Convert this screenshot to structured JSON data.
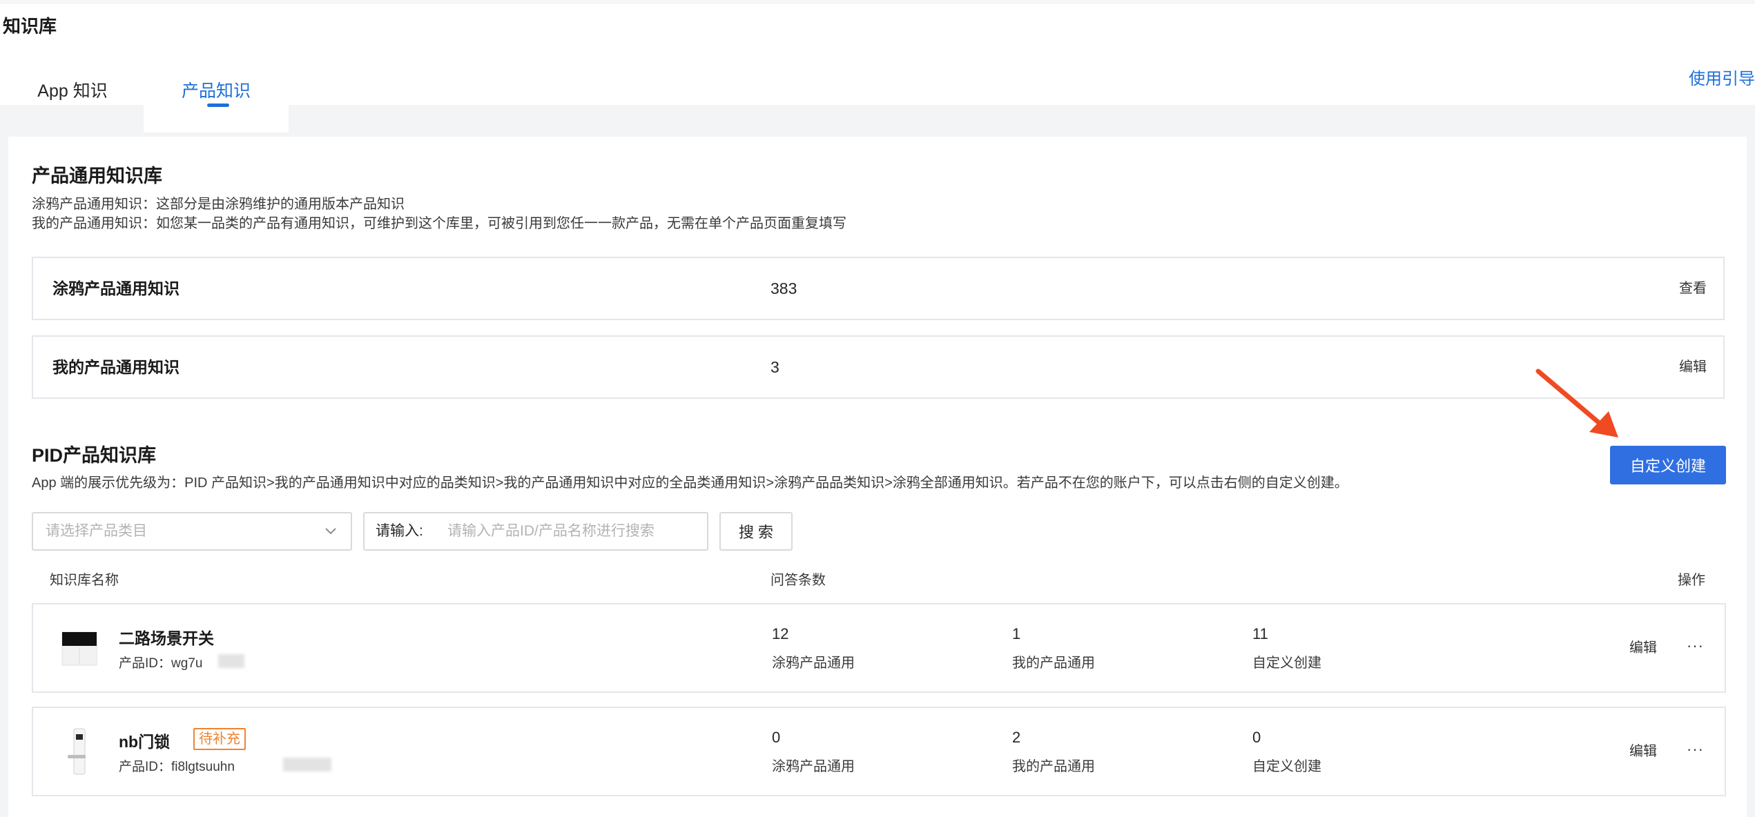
{
  "page": {
    "title": "知识库",
    "guide_link": "使用引导"
  },
  "tabs": [
    {
      "label": "App 知识",
      "active": false
    },
    {
      "label": "产品知识",
      "active": true
    }
  ],
  "general_kb": {
    "title": "产品通用知识库",
    "desc_line1": "涂鸦产品通用知识：这部分是由涂鸦维护的通用版本产品知识",
    "desc_line2": "我的产品通用知识：如您某一品类的产品有通用知识，可维护到这个库里，可被引用到您任一一款产品，无需在单个产品页面重复填写",
    "rows": [
      {
        "name": "涂鸦产品通用知识",
        "count": "383",
        "action": "查看"
      },
      {
        "name": "我的产品通用知识",
        "count": "3",
        "action": "编辑"
      }
    ]
  },
  "pid_kb": {
    "title": "PID产品知识库",
    "desc": "App 端的展示优先级为：PID 产品知识>我的产品通用知识中对应的品类知识>我的产品通用知识中对应的全品类通用知识>涂鸦产品品类知识>涂鸦全部通用知识。若产品不在您的账户下，可以点击右侧的自定义创建。",
    "create_button": "自定义创建",
    "filter": {
      "category_placeholder": "请选择产品类目",
      "input_label": "请输入:",
      "input_placeholder": "请输入产品ID/产品名称进行搜索",
      "search_button": "搜 索"
    },
    "table_headers": {
      "name": "知识库名称",
      "qa_count": "问答条数",
      "ops": "操作"
    },
    "products": [
      {
        "name": "二路场景开关",
        "badge": "",
        "id_text": "产品ID：wg7u",
        "stats": [
          {
            "value": "12",
            "label": "涂鸦产品通用"
          },
          {
            "value": "1",
            "label": "我的产品通用"
          },
          {
            "value": "11",
            "label": "自定义创建"
          }
        ],
        "edit": "编辑",
        "more": "···"
      },
      {
        "name": "nb门锁",
        "badge": "待补充",
        "id_text": "产品ID：fi8lgtsuuhn",
        "stats": [
          {
            "value": "0",
            "label": "涂鸦产品通用"
          },
          {
            "value": "2",
            "label": "我的产品通用"
          },
          {
            "value": "0",
            "label": "自定义创建"
          }
        ],
        "edit": "编辑",
        "more": "···"
      }
    ]
  },
  "colors": {
    "accent": "#1e6fd9",
    "button": "#2f6fe2",
    "badge": "#f0832f",
    "arrow": "#f04a23"
  }
}
